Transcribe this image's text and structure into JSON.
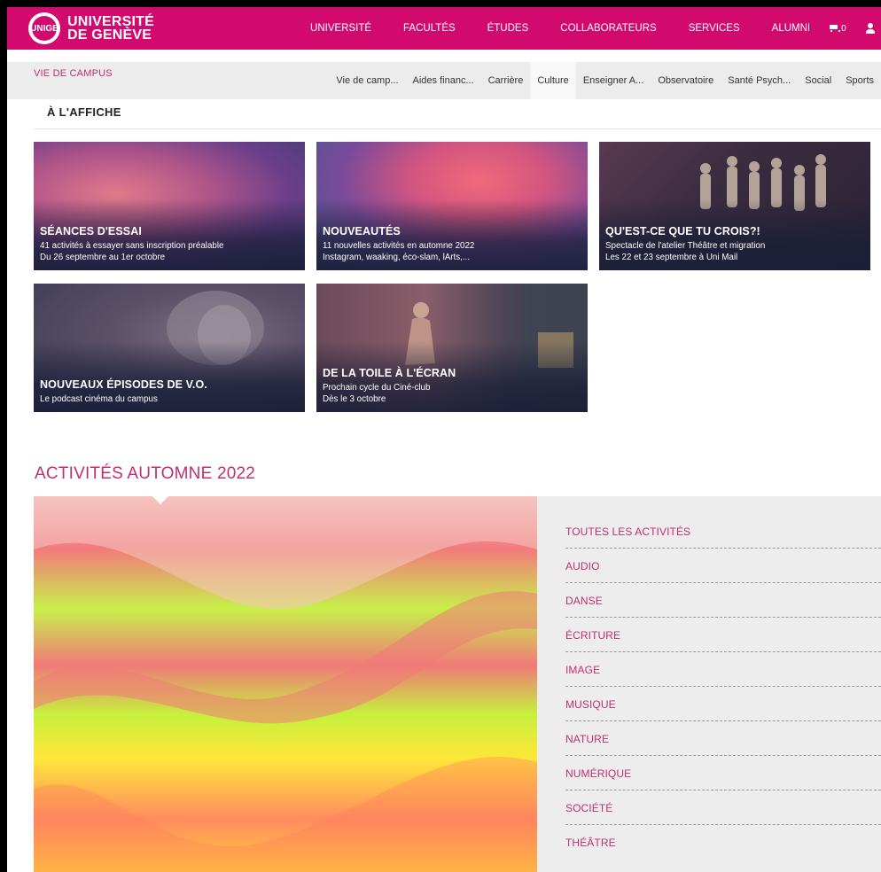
{
  "header": {
    "logo_line1": "UNIVERSITÉ",
    "logo_line2": "DE GENÈVE",
    "logo_crest": "UNIGE",
    "nav": [
      "UNIVERSITÉ",
      "FACULTÉS",
      "ÉTUDES",
      "COLLABORATEURS",
      "SERVICES",
      "ALUMNI"
    ],
    "cart_count": "0",
    "icons": [
      "cart-icon",
      "user-icon"
    ],
    "brand_color": "#d20a6e"
  },
  "subnav": {
    "section": "VIE DE CAMPUS",
    "items": [
      "Vie de camp...",
      "Aides financ...",
      "Carrière",
      "Culture",
      "Enseigner A...",
      "Observatoire",
      "Santé Psych...",
      "Social",
      "Sports"
    ],
    "active": "Culture"
  },
  "affiche": {
    "title": "À L'AFFICHE",
    "cards": [
      {
        "title": "SÉANCES D'ESSAI",
        "line1": "41 activités à essayer sans inscription préalable",
        "line2": "Du 26 septembre au 1er octobre"
      },
      {
        "title": "NOUVEAUTÉS",
        "line1": "11 nouvelles activités en automne 2022",
        "line2": "Instagram, waaking, éco-slam, lArts,..."
      },
      {
        "title": "QU'EST-CE QUE TU CROIS?!",
        "line1": "Spectacle de l'atelier Théâtre et migration",
        "line2": "Les 22 et 23 septembre à Uni Mail"
      },
      {
        "title": "NOUVEAUX ÉPISODES DE V.O.",
        "line1": "Le podcast cinéma du campus",
        "line2": ""
      },
      {
        "title": "DE LA TOILE À L'ÉCRAN",
        "line1": "Prochain cycle du Ciné-club",
        "line2": "Dès le 3 octobre"
      }
    ]
  },
  "activities": {
    "title": "ACTIVITÉS AUTOMNE 2022",
    "items": [
      "TOUTES LES ACTIVITÉS",
      "AUDIO",
      "DANSE",
      "ÉCRITURE",
      "IMAGE",
      "MUSIQUE",
      "NATURE",
      "NUMÉRIQUE",
      "SOCIÉTÉ",
      "THÉÂTRE"
    ],
    "accent": "#c0306e"
  }
}
